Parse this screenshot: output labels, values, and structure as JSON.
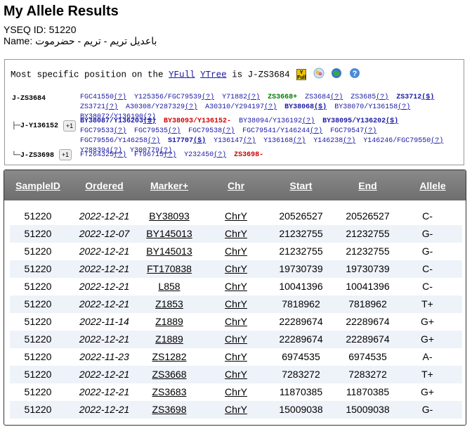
{
  "page": {
    "title": "My Allele Results",
    "yseq_id": "YSEQ ID: 51220",
    "name": "Name: باعديل تريم - تريم - حضرموت"
  },
  "position_panel": {
    "prefix": "Most specific position on the ",
    "link1": "YFull",
    "space": " ",
    "link2": "YTree",
    "suffix": " is J-ZS3684",
    "icons": [
      "yfull-icon",
      "globe-icon",
      "map-icon",
      "help-icon"
    ],
    "rows": [
      {
        "label": "J-ZS3684",
        "plus": "",
        "snps": [
          {
            "t": "FGC41550",
            "s": "(?)"
          },
          {
            "t": "Y125356/FGC79539",
            "s": "(?)"
          },
          {
            "t": "Y71882",
            "s": "(?)"
          },
          {
            "t": "ZS3668+",
            "s": "",
            "c": "green"
          },
          {
            "t": "ZS3684",
            "s": "(?)"
          },
          {
            "t": "ZS3685",
            "s": "(?)"
          },
          {
            "t": "ZS3712",
            "s": "($)",
            "c": "bold"
          },
          {
            "t": "ZS3721",
            "s": "(?)"
          },
          {
            "t": "A30308/Y287329",
            "s": "(?)"
          },
          {
            "t": "A30310/Y294197",
            "s": "(?)"
          },
          {
            "t": "BY38068",
            "s": "($)",
            "c": "bold"
          },
          {
            "t": "BY38070/Y136158",
            "s": "(?)"
          },
          {
            "t": "BY38072/Y136190",
            "s": "(?)"
          }
        ]
      },
      {
        "label": "J-Y136152",
        "plus": "+1",
        "snps": [
          {
            "t": "BY38087/Y136203",
            "s": "($)",
            "c": "bold"
          },
          {
            "t": "BY38093/Y136152-",
            "s": "",
            "c": "red"
          },
          {
            "t": "BY38094/Y136192",
            "s": "(?)"
          },
          {
            "t": "BY38095/Y136202",
            "s": "($)",
            "c": "bold"
          },
          {
            "t": "FGC79533",
            "s": "(?)"
          },
          {
            "t": "FGC79535",
            "s": "(?)"
          },
          {
            "t": "FGC79538",
            "s": "(?)"
          },
          {
            "t": "FGC79541/Y146244",
            "s": "(?)"
          },
          {
            "t": "FGC79547",
            "s": "(?)"
          },
          {
            "t": "FGC79556/Y146258",
            "s": "(?)"
          },
          {
            "t": "S17707",
            "s": "($)",
            "c": "bold"
          },
          {
            "t": "Y136147",
            "s": "(?)"
          },
          {
            "t": "Y136168",
            "s": "(?)"
          },
          {
            "t": "Y146238",
            "s": "(?)"
          },
          {
            "t": "Y146246/FGC79550",
            "s": "(?)"
          },
          {
            "t": "Y288394",
            "s": "(?)"
          },
          {
            "t": "Y300779",
            "s": "(?)"
          }
        ]
      },
      {
        "label": "J-ZS3698",
        "plus": "+1",
        "snps": [
          {
            "t": "FT264325",
            "s": "(?)"
          },
          {
            "t": "FT96715",
            "s": "(?)"
          },
          {
            "t": "Y232450",
            "s": "(?)"
          },
          {
            "t": "ZS3698-",
            "s": "",
            "c": "red"
          }
        ]
      }
    ]
  },
  "table": {
    "headers": [
      "SampleID",
      "Ordered",
      "Marker+",
      "Chr",
      "Start",
      "End",
      "Allele"
    ],
    "rows": [
      [
        "51220",
        "2022-12-21",
        "BY38093",
        "ChrY",
        "20526527",
        "20526527",
        "C-"
      ],
      [
        "51220",
        "2022-12-07",
        "BY145013",
        "ChrY",
        "21232755",
        "21232755",
        "G-"
      ],
      [
        "51220",
        "2022-12-21",
        "BY145013",
        "ChrY",
        "21232755",
        "21232755",
        "G-"
      ],
      [
        "51220",
        "2022-12-21",
        "FT170838",
        "ChrY",
        "19730739",
        "19730739",
        "C-"
      ],
      [
        "51220",
        "2022-12-21",
        "L858",
        "ChrY",
        "10041396",
        "10041396",
        "C-"
      ],
      [
        "51220",
        "2022-12-21",
        "Z1853",
        "ChrY",
        "7818962",
        "7818962",
        "T+"
      ],
      [
        "51220",
        "2022-11-14",
        "Z1889",
        "ChrY",
        "22289674",
        "22289674",
        "G+"
      ],
      [
        "51220",
        "2022-12-21",
        "Z1889",
        "ChrY",
        "22289674",
        "22289674",
        "G+"
      ],
      [
        "51220",
        "2022-11-23",
        "ZS1282",
        "ChrY",
        "6974535",
        "6974535",
        "A-"
      ],
      [
        "51220",
        "2022-12-21",
        "ZS3668",
        "ChrY",
        "7283272",
        "7283272",
        "T+"
      ],
      [
        "51220",
        "2022-12-21",
        "ZS3683",
        "ChrY",
        "11870385",
        "11870385",
        "G+"
      ],
      [
        "51220",
        "2022-12-21",
        "ZS3698",
        "ChrY",
        "15009038",
        "15009038",
        "G-"
      ]
    ]
  }
}
